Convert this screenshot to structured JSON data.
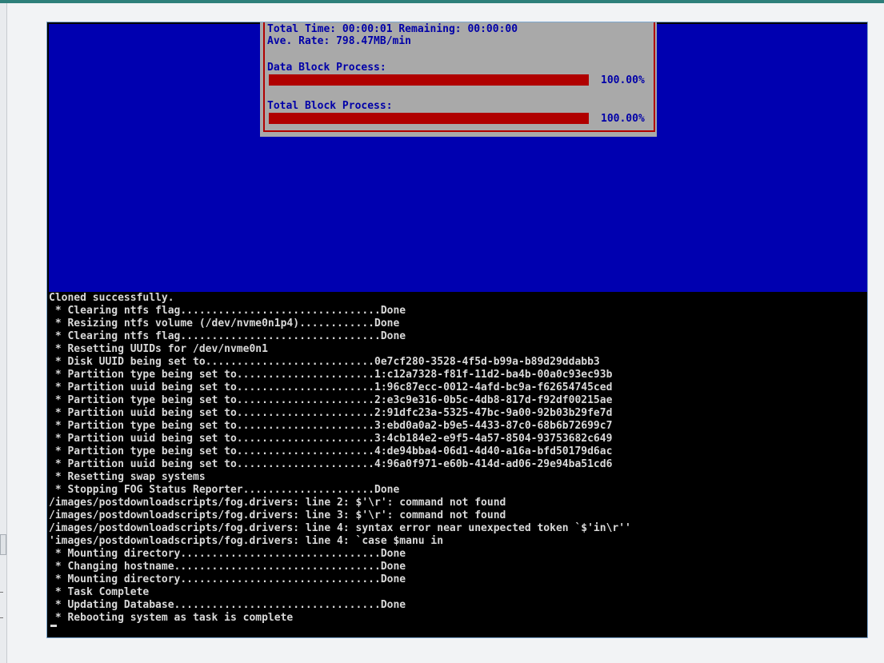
{
  "progress": {
    "time_line": "Total Time: 00:00:01 Remaining: 00:00:00",
    "rate_line": "Ave. Rate: 798.47MB/min",
    "data_block_label": "Data Block Process:",
    "data_block_percent": "100.00%",
    "data_block_fraction": 1.0,
    "total_block_label": "Total Block Process:",
    "total_block_percent": "100.00%",
    "total_block_fraction": 1.0
  },
  "terminal": {
    "lines": [
      "Cloned successfully.",
      " * Clearing ntfs flag................................Done",
      " * Resizing ntfs volume (/dev/nvme0n1p4)............Done",
      " * Clearing ntfs flag................................Done",
      " * Resetting UUIDs for /dev/nvme0n1",
      " * Disk UUID being set to...........................0e7cf280-3528-4f5d-b99a-b89d29ddabb3",
      " * Partition type being set to......................1:c12a7328-f81f-11d2-ba4b-00a0c93ec93b",
      " * Partition uuid being set to......................1:96c87ecc-0012-4afd-bc9a-f62654745ced",
      " * Partition type being set to......................2:e3c9e316-0b5c-4db8-817d-f92df00215ae",
      " * Partition uuid being set to......................2:91dfc23a-5325-47bc-9a00-92b03b29fe7d",
      " * Partition type being set to......................3:ebd0a0a2-b9e5-4433-87c0-68b6b72699c7",
      " * Partition uuid being set to......................3:4cb184e2-e9f5-4a57-8504-93753682c649",
      " * Partition type being set to......................4:de94bba4-06d1-4d40-a16a-bfd50179d6ac",
      " * Partition uuid being set to......................4:96a0f971-e60b-414d-ad06-29e94ba51cd6",
      " * Resetting swap systems",
      " * Stopping FOG Status Reporter.....................Done",
      "/images/postdownloadscripts/fog.drivers: line 2: $'\\r': command not found",
      "/images/postdownloadscripts/fog.drivers: line 3: $'\\r': command not found",
      "/images/postdownloadscripts/fog.drivers: line 4: syntax error near unexpected token `$'in\\r''",
      "'images/postdownloadscripts/fog.drivers: line 4: `case $manu in",
      " * Mounting directory................................Done",
      " * Changing hostname.................................Done",
      " * Mounting directory................................Done",
      " * Task Complete",
      " * Updating Database.................................Done",
      " * Rebooting system as task is complete"
    ]
  }
}
